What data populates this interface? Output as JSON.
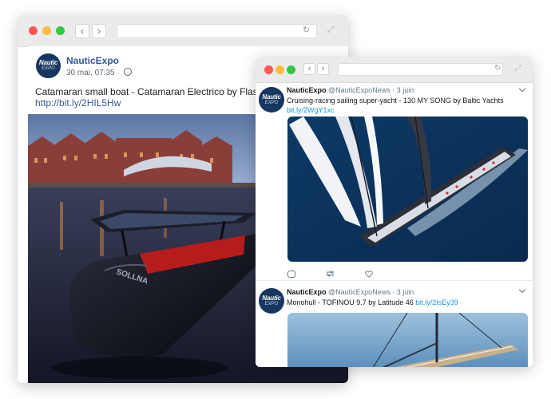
{
  "facebook_window": {
    "page_name": "NauticExpo",
    "logo_text": [
      "Nautic",
      "EXPO"
    ],
    "post_date": "30 mai, 07:35 ·",
    "post_text": "Catamaran small boat - Catamaran Electrico by Flash Catamarans",
    "post_link": "http://bit.ly/2HIL5Hw",
    "image": "Black electric catamaran with a solar-panel roof moored in a harbour at dusk, historic brick warehouses in the background",
    "hull_text": "SOLLNA"
  },
  "twitter_window": {
    "tweets": [
      {
        "name": "NauticExpo",
        "handle": "@NauticExpoNews",
        "separator": "·",
        "date": "3 juin",
        "text": "Cruising-racing sailing super-yacht - 130 MY SONG by Baltic Yachts",
        "link": "bit.ly/2WgY1xc",
        "image": "Aerial view of a sailing super-yacht with white sails on deep blue sea"
      },
      {
        "name": "NauticExpo",
        "handle": "@NauticExpoNews",
        "separator": "·",
        "date": "3 juin",
        "text": "Monohull - TOFINOU 9.7 by Latitude 46",
        "link": "bit.ly/2IsEy39",
        "image": "Teak-deck sailboat bow on calm blue water"
      }
    ]
  },
  "icons": [
    "close-dot",
    "minimize-dot",
    "maximize-dot",
    "back-icon",
    "forward-icon",
    "reload-icon",
    "expand-icon",
    "globe-icon",
    "caret-icon",
    "reply-icon",
    "retweet-icon",
    "like-icon"
  ],
  "colors": {
    "link_blue_facebook": "#365899",
    "link_blue_twitter": "#1b95e0",
    "logo_navy": "#17365f",
    "traffic_red": "#fc5753",
    "traffic_yellow": "#fdbc40",
    "traffic_green": "#33c748"
  }
}
